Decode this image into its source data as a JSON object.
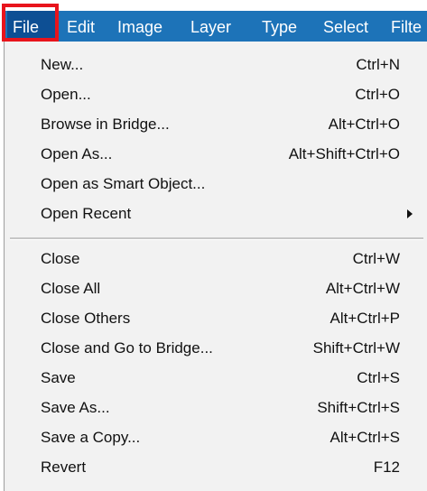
{
  "menubar": {
    "items": [
      {
        "label": "File",
        "active": true
      },
      {
        "label": "Edit",
        "active": false
      },
      {
        "label": "Image",
        "active": false
      },
      {
        "label": "Layer",
        "active": false
      },
      {
        "label": "Type",
        "active": false
      },
      {
        "label": "Select",
        "active": false
      },
      {
        "label": "Filte",
        "active": false
      }
    ]
  },
  "colors": {
    "menubar_bg": "#1d73b8",
    "active_bg": "#0d4f94",
    "highlight_border": "#e8141c",
    "dropdown_bg": "#f2f2f2"
  },
  "file_menu": {
    "group1": [
      {
        "label": "New...",
        "shortcut": "Ctrl+N"
      },
      {
        "label": "Open...",
        "shortcut": "Ctrl+O"
      },
      {
        "label": "Browse in Bridge...",
        "shortcut": "Alt+Ctrl+O"
      },
      {
        "label": "Open As...",
        "shortcut": "Alt+Shift+Ctrl+O"
      },
      {
        "label": "Open as Smart Object...",
        "shortcut": ""
      },
      {
        "label": "Open Recent",
        "shortcut": "",
        "submenu_icon": "chevron-right-icon"
      }
    ],
    "group2": [
      {
        "label": "Close",
        "shortcut": "Ctrl+W"
      },
      {
        "label": "Close All",
        "shortcut": "Alt+Ctrl+W"
      },
      {
        "label": "Close Others",
        "shortcut": "Alt+Ctrl+P"
      },
      {
        "label": "Close and Go to Bridge...",
        "shortcut": "Shift+Ctrl+W"
      },
      {
        "label": "Save",
        "shortcut": "Ctrl+S"
      },
      {
        "label": "Save As...",
        "shortcut": "Shift+Ctrl+S"
      },
      {
        "label": "Save a Copy...",
        "shortcut": "Alt+Ctrl+S"
      },
      {
        "label": "Revert",
        "shortcut": "F12"
      }
    ]
  }
}
